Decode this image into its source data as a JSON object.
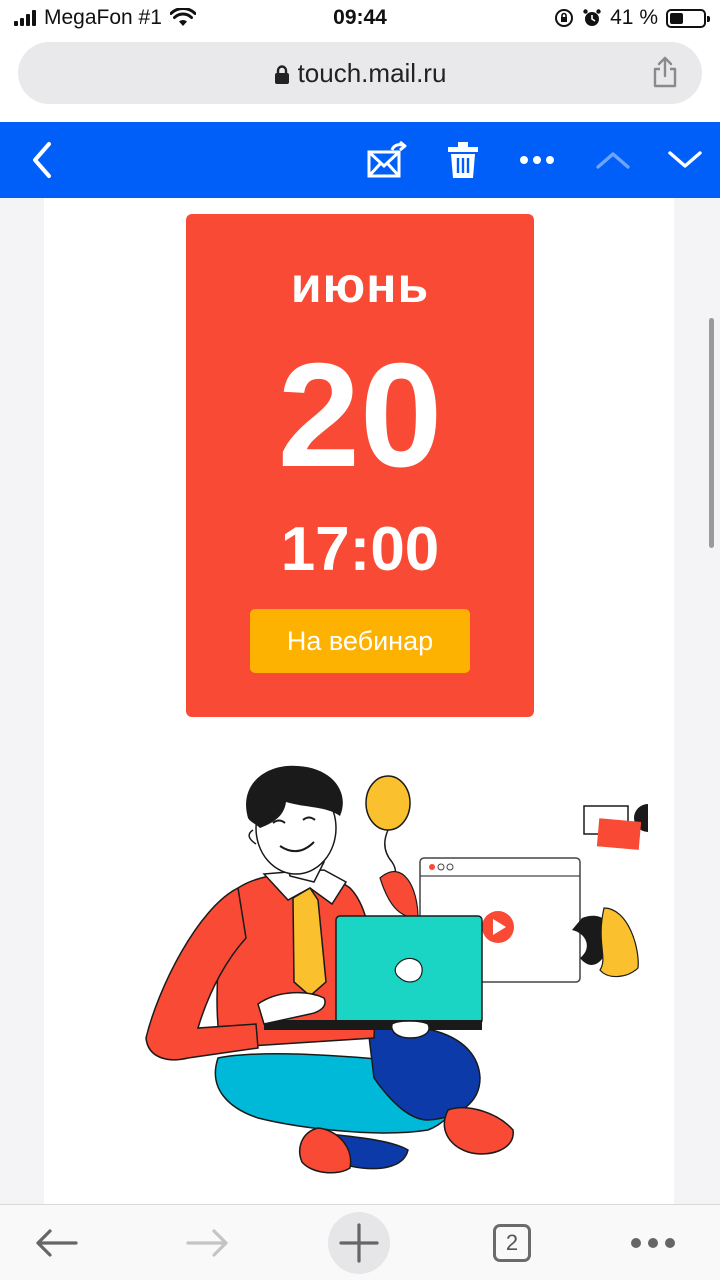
{
  "status_bar": {
    "carrier": "MegaFon #1",
    "time": "09:44",
    "battery_text": "41 %",
    "battery_level": 0.41
  },
  "browser": {
    "url": "touch.mail.ru",
    "open_tabs": "2"
  },
  "toolbar": {
    "color": "#005ff9",
    "icons": [
      "back-icon",
      "move-to-folder-icon",
      "trash-icon",
      "more-icon",
      "previous-message-icon",
      "next-message-icon"
    ]
  },
  "event": {
    "month": "июнь",
    "day": "20",
    "time": "17:00",
    "button_label": "На вебинар",
    "card_color": "#f94a35",
    "button_color": "#fdb100"
  },
  "bottom_bar": {
    "icons": [
      "back-arrow-icon",
      "forward-arrow-icon",
      "new-tab-icon",
      "tabs-icon",
      "menu-icon"
    ]
  }
}
